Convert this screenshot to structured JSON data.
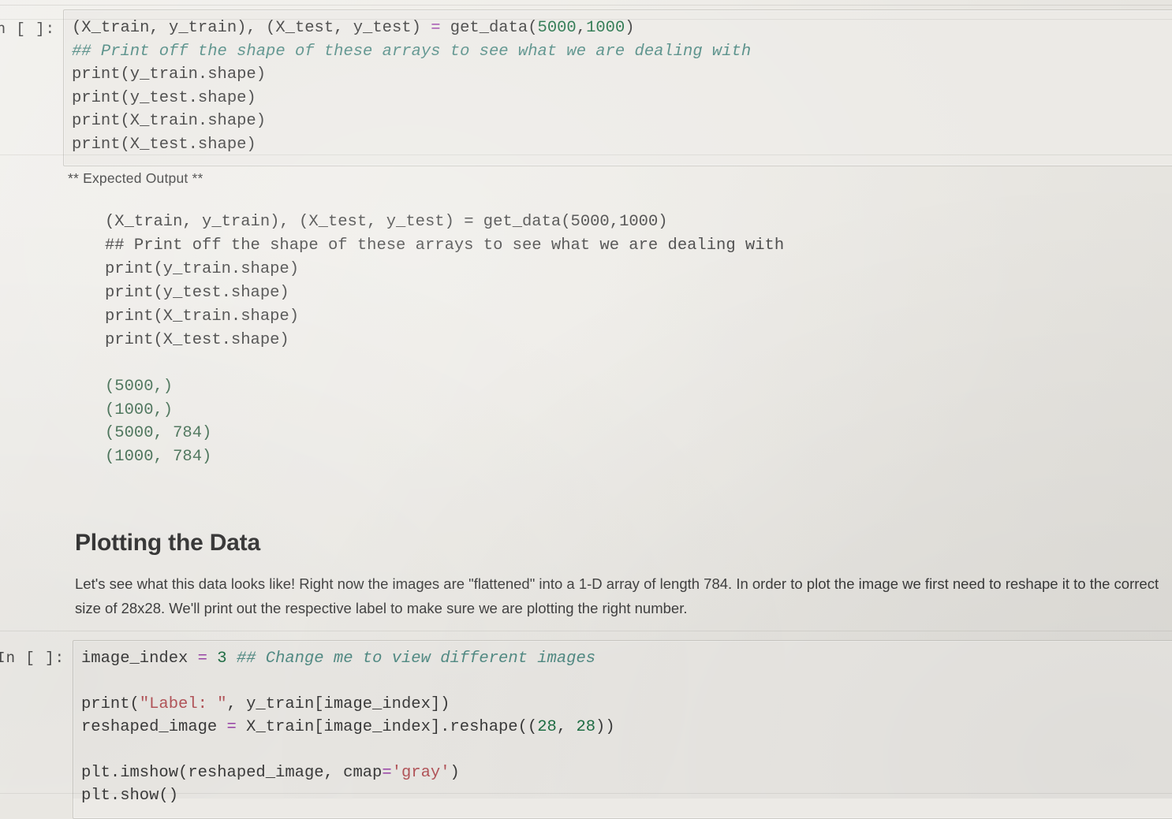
{
  "notebook": {
    "cells": [
      {
        "type": "code",
        "prompt": "n [ ]:",
        "lines": {
          "l1_a": "(X_train, y_train), (X_test, y_test) ",
          "l1_eq": "=",
          "l1_b": " get_data(",
          "l1_n1": "5000",
          "l1_comma": ",",
          "l1_n2": "1000",
          "l1_c": ")",
          "l2_comment": "## Print off the shape of these arrays to see what we are dealing with",
          "l3": "print(y_train.shape)",
          "l4": "print(y_test.shape)",
          "l5": "print(X_train.shape)",
          "l6": "print(X_test.shape)"
        }
      }
    ],
    "expected_output": {
      "label": "** Expected Output **",
      "code_lines": {
        "l1_a": "(X_train, y_train), (X_test, y_test) ",
        "l1_eq": "=",
        "l1_b": " get_data(",
        "l1_n1": "5000",
        "l1_comma": ",",
        "l1_n2": "1000",
        "l1_c": ")",
        "l2_comment": "## Print off the shape of these arrays to see what we are dealing with",
        "l3": "print(y_train.shape)",
        "l4": "print(y_test.shape)",
        "l5": "print(X_train.shape)",
        "l6": "print(X_test.shape)"
      },
      "values": [
        "(5000,)",
        "(1000,)",
        "(5000, 784)",
        "(1000, 784)"
      ]
    },
    "plotting_section": {
      "heading": "Plotting the Data",
      "paragraph": "Let's see what this data looks like! Right now the images are \"flattened\" into a 1-D array of length 784. In order to plot the image we first need to reshape it to the correct size of 28x28. We'll print out the respective label to make sure we are plotting the right number."
    },
    "plot_cell": {
      "prompt": "In [ ]:",
      "lines": {
        "l1_a": "image_index ",
        "l1_eq": "=",
        "l1_sp": " ",
        "l1_num": "3",
        "l1_b": " ",
        "l1_comment": "## Change me to view different images",
        "l3_a": "print(",
        "l3_str": "\"Label: \"",
        "l3_b": ", y_train[image_index])",
        "l4_a": "reshaped_image ",
        "l4_eq": "=",
        "l4_b": " X_train[image_index].reshape((",
        "l4_n1": "28",
        "l4_comma": ", ",
        "l4_n2": "28",
        "l4_c": "))",
        "l6_a": "plt.imshow(reshaped_image, cmap",
        "l6_eq": "=",
        "l6_str": "'gray'",
        "l6_b": ")",
        "l7": "plt.show()"
      }
    }
  },
  "theme": {
    "page_background": "#eceae5",
    "cell_background": "#eceae6",
    "cell_border": "#cbc9c3",
    "code_text": "#3b3b3b",
    "comment_color": "#4f8a83",
    "operator_color": "#9a42a8",
    "number_color": "#1f6f45",
    "string_color": "#b5555a",
    "output_text": "#3f6b4f",
    "heading_color": "#2e2e2e",
    "body_text": "#3a3a3a"
  }
}
